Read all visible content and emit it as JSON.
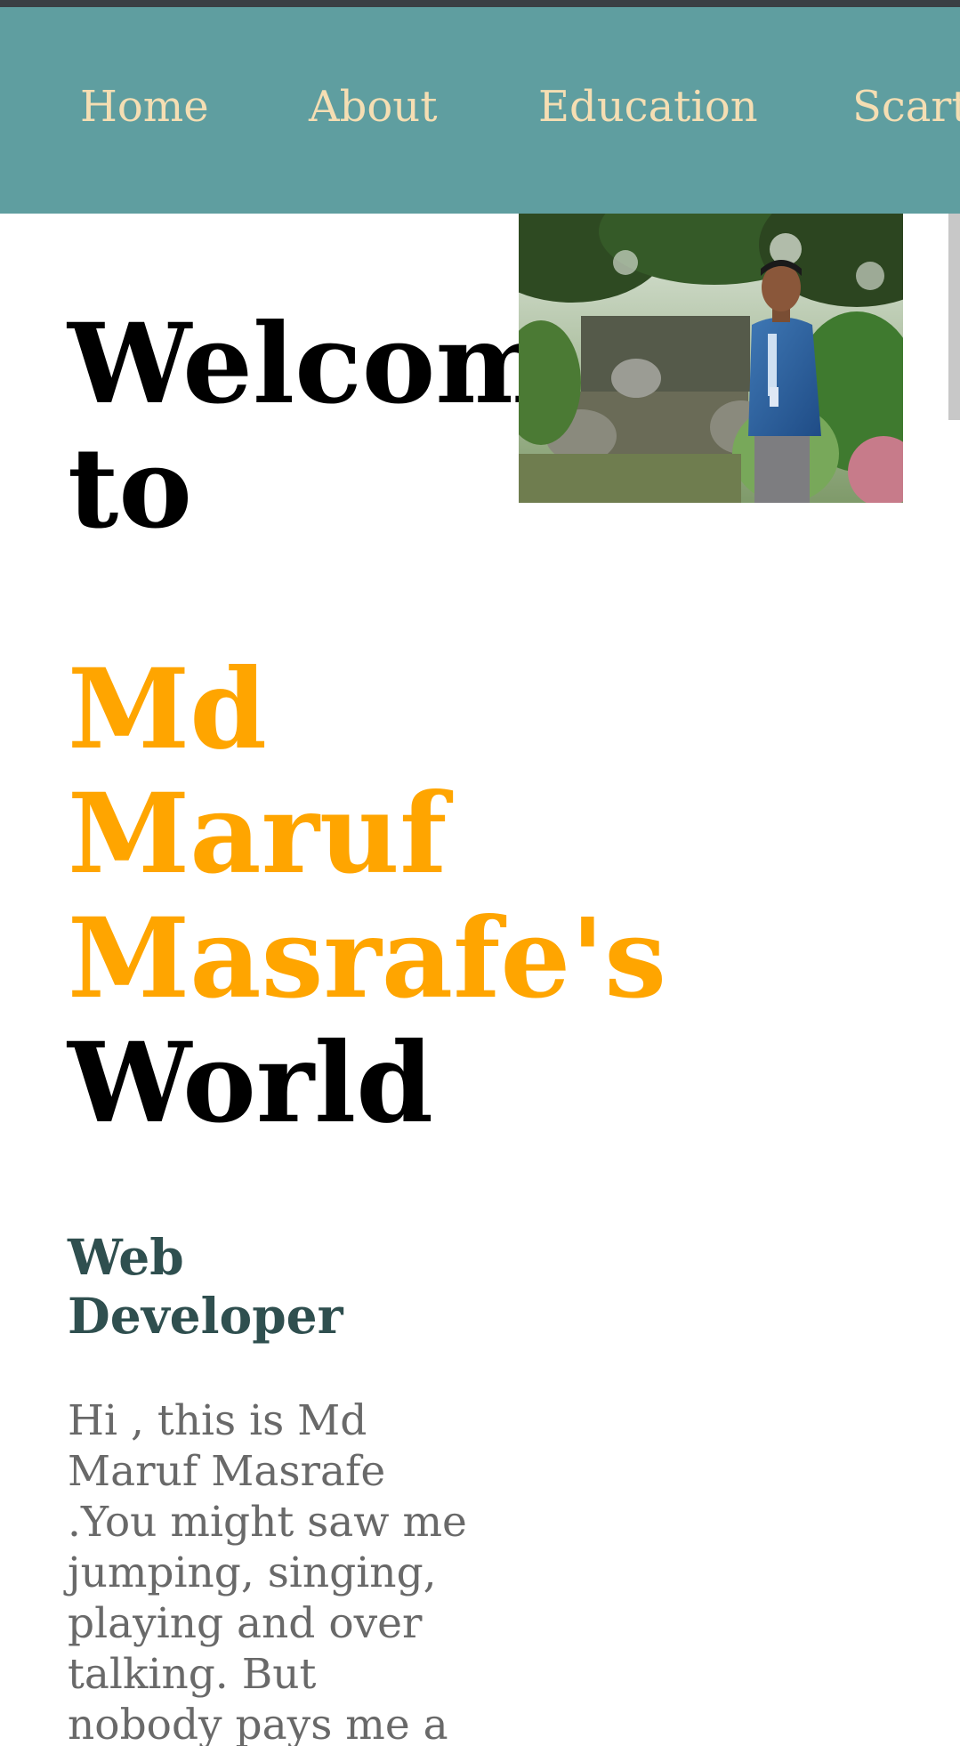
{
  "nav": {
    "items": [
      {
        "label": "Home"
      },
      {
        "label": "About"
      },
      {
        "label": "Education"
      },
      {
        "label": "Scarti"
      }
    ]
  },
  "hero": {
    "title_lines": [
      "Welcome",
      "to"
    ],
    "name_lines": [
      "Md",
      "Maruf",
      "Masrafe's"
    ],
    "world": "World"
  },
  "role": {
    "lines": [
      "Web",
      "Developer"
    ]
  },
  "bio": {
    "lines": [
      "Hi , this is Md",
      "Maruf Masrafe",
      ".You might saw me",
      "jumping, singing,",
      "playing and over",
      "talking. But",
      "nobody pays me a"
    ]
  },
  "colors": {
    "nav_background": "#5f9ea0",
    "nav_text": "#f5deb3",
    "name_accent": "#ffa500",
    "role_text": "#2f4f4f",
    "bio_text": "#696969"
  },
  "icons": {
    "profile": "profile-photo"
  }
}
